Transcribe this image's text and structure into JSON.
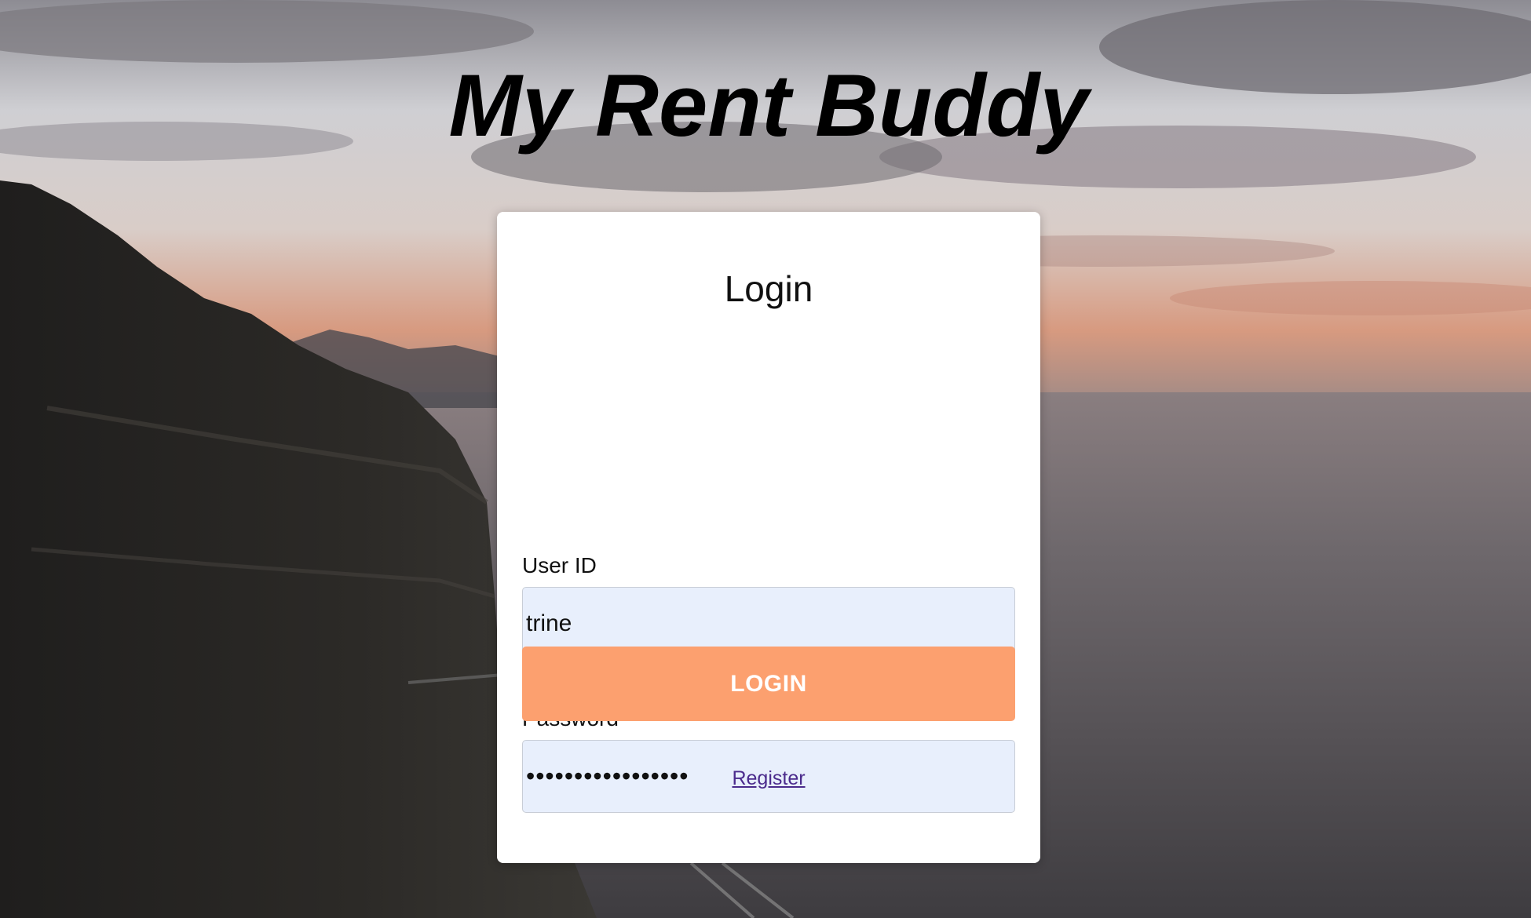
{
  "app": {
    "title": "My Rent Buddy"
  },
  "login_form": {
    "heading": "Login",
    "user_id": {
      "label": "User ID",
      "value": "trine"
    },
    "password": {
      "label": "Password",
      "value": "•••••••••••••••••"
    },
    "submit_label": "LOGIN",
    "register_link": "Register"
  },
  "colors": {
    "button_bg": "#fca06f",
    "input_bg": "#e8effc",
    "link": "#4b2b8c"
  }
}
